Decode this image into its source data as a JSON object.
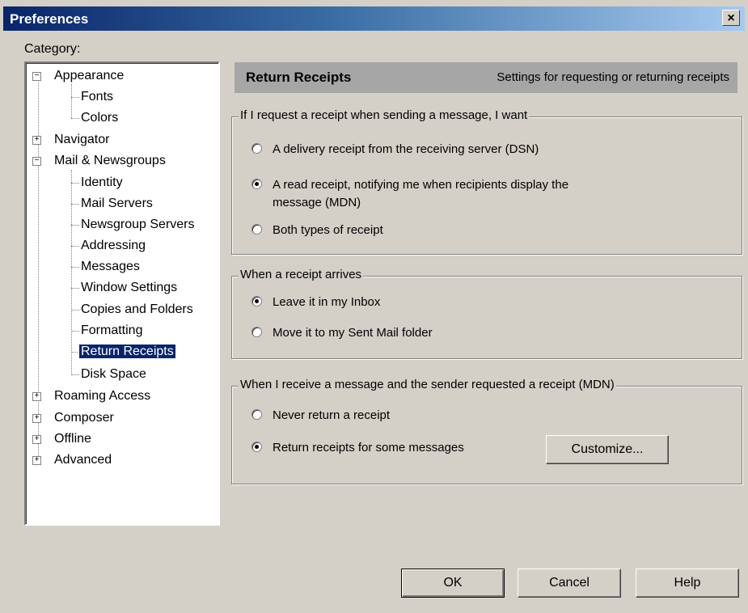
{
  "window": {
    "title": "Preferences",
    "close": "×"
  },
  "category": {
    "label": "Category:"
  },
  "tree": [
    {
      "label": "Appearance",
      "expander": "−"
    },
    {
      "label": "Fonts"
    },
    {
      "label": "Colors"
    },
    {
      "label": "Navigator",
      "expander": "+"
    },
    {
      "label": "Mail & Newsgroups",
      "expander": "−"
    },
    {
      "label": "Identity"
    },
    {
      "label": "Mail Servers"
    },
    {
      "label": "Newsgroup Servers"
    },
    {
      "label": "Addressing"
    },
    {
      "label": "Messages"
    },
    {
      "label": "Window Settings"
    },
    {
      "label": "Copies and Folders"
    },
    {
      "label": "Formatting"
    },
    {
      "label": "Return Receipts",
      "selected": true
    },
    {
      "label": "Disk Space"
    },
    {
      "label": "Roaming Access",
      "expander": "+"
    },
    {
      "label": "Composer",
      "expander": "+"
    },
    {
      "label": "Offline",
      "expander": "+"
    },
    {
      "label": "Advanced",
      "expander": "+"
    }
  ],
  "header": {
    "title": "Return Receipts",
    "description": "Settings for requesting or returning receipts"
  },
  "group1": {
    "legend": "If I request a receipt when sending a message, I want",
    "options": [
      {
        "label": "A delivery receipt from the receiving server (DSN)",
        "checked": false
      },
      {
        "label": "A read receipt, notifying me when recipients display the",
        "label2": "message (MDN)",
        "checked": true
      },
      {
        "label": "Both types of receipt",
        "checked": false
      }
    ]
  },
  "group2": {
    "legend": "When a receipt arrives",
    "options": [
      {
        "label": "Leave it in my Inbox",
        "checked": true
      },
      {
        "label": "Move it to my Sent Mail folder",
        "checked": false
      }
    ]
  },
  "group3": {
    "legend": "When I receive a message and the sender requested a receipt (MDN)",
    "options": [
      {
        "label": "Never return a receipt",
        "checked": false
      },
      {
        "label": "Return receipts for some messages",
        "checked": true
      }
    ],
    "customize": "Customize..."
  },
  "buttons": {
    "ok": "OK",
    "cancel": "Cancel",
    "help": "Help"
  }
}
